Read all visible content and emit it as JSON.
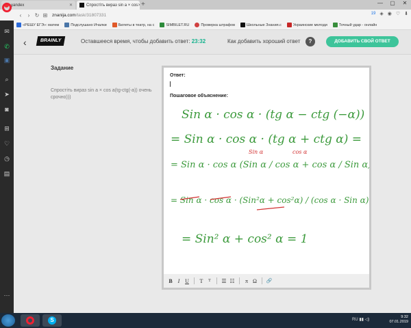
{
  "browser": {
    "tabs": [
      {
        "label": "yandex"
      },
      {
        "label": "Спростіть вираз sin a × cos"
      }
    ],
    "new_tab": "+",
    "url_domain": "znanija.com",
    "url_path": "/task/31807331",
    "counter": "19",
    "window_controls": {
      "min": "—",
      "max": "▢",
      "close": "✕"
    }
  },
  "bookmarks": [
    {
      "label": "«РЕШУ ЕГЭ»: матем",
      "color": "#2b6ad9"
    },
    {
      "label": "Подслушано Ичалки",
      "color": "#4a76a8"
    },
    {
      "label": "Билеты в театр, на с",
      "color": "#e05a2a"
    },
    {
      "label": "SIMBILET.RU",
      "color": "#2c8a3a"
    },
    {
      "label": "Проверка штрафов",
      "color": "#d04040"
    },
    {
      "label": "Школьные Знания.c",
      "color": "#111111"
    },
    {
      "label": "Украинские мелоди",
      "color": "#c62828"
    },
    {
      "label": "Точный удар - онлайн",
      "color": "#388e3c"
    }
  ],
  "header": {
    "logo": "BRAINLY",
    "remaining_label": "Оставшееся время, чтобы добавить ответ:",
    "remaining_time": "23:32",
    "how_to": "Как добавить хороший ответ",
    "help": "?",
    "add_answer": "ДОБАВИТЬ СВОЙ ОТВЕТ"
  },
  "task": {
    "title": "Задание",
    "text": "Спростіть вираз sin a × cos a(tg-ctg(-a)) очень срочно)))"
  },
  "answer": {
    "answer_label": "Ответ:",
    "explanation_label": "Пошаговое объяснение:",
    "handwriting": [
      "Sin α · cos α · (tg α − ctg (−α)) =",
      "= Sin α · cos α · (tg α + ctg α) =",
      "= Sin α · cos α (Sin α / cos α + cos α / Sin α) =",
      "= Sin α · cos α · (Sin²α + cos²α) / (cos α · Sin α) =",
      "= Sin² α + cos² α = 1"
    ],
    "annotations": [
      "Sin α",
      "cos α"
    ],
    "ink_color": "#3c9a3c",
    "mark_color": "#d23030"
  },
  "editor_toolbar": {
    "bold": "B",
    "italic": "I",
    "underline": "U",
    "font_size": "T",
    "font_size_small": "T",
    "list_bullets": "☰",
    "list_numbers": "☷",
    "pi": "π",
    "omega": "Ω",
    "attach": "🔗"
  },
  "taskbar": {
    "time": "9:32",
    "date": "07.01.2019",
    "lang": "RU"
  },
  "colors": {
    "accent": "#3dc49a",
    "timer": "#15b28d"
  }
}
